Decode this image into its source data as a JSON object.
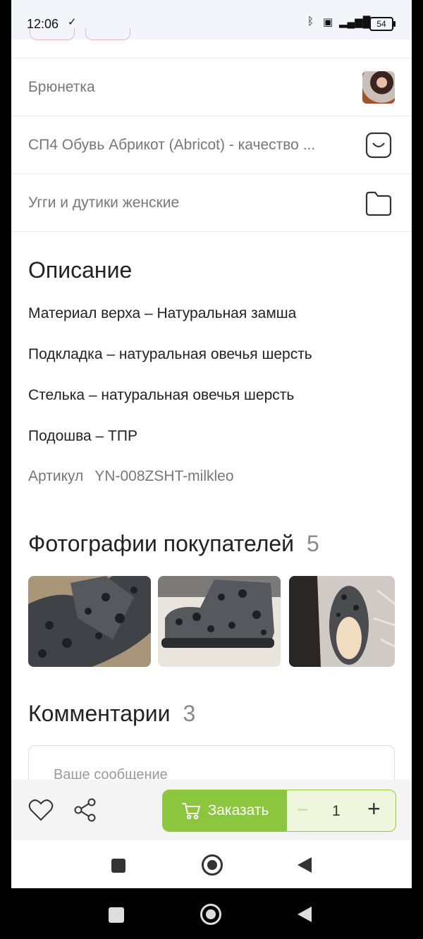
{
  "status": {
    "time": "12:06",
    "battery": "54"
  },
  "rows": [
    {
      "label": "Брюнетка"
    },
    {
      "label": "СП4 Обувь Абрикот (Abricot) - качество ..."
    },
    {
      "label": "Угги и дутики женские"
    }
  ],
  "description": {
    "title": "Описание",
    "lines": [
      "Материал верха – Натуральная замша",
      "Подкладка – натуральная овечья шерсть",
      "Стелька – натуральная овечья шерсть",
      "Подошва – ТПР"
    ],
    "sku_label": "Артикул",
    "sku_value": "YN-008ZSHT-milkleo"
  },
  "photos": {
    "title": "Фотографии покупателей",
    "count": "5"
  },
  "comments": {
    "title": "Комментарии",
    "count": "3",
    "placeholder": "Ваше сообщение"
  },
  "bottom": {
    "order_label": "Заказать",
    "quantity": "1",
    "minus": "−",
    "plus": "+"
  },
  "colors": {
    "accent": "#8cc63f",
    "accent_light": "#eff6de"
  }
}
